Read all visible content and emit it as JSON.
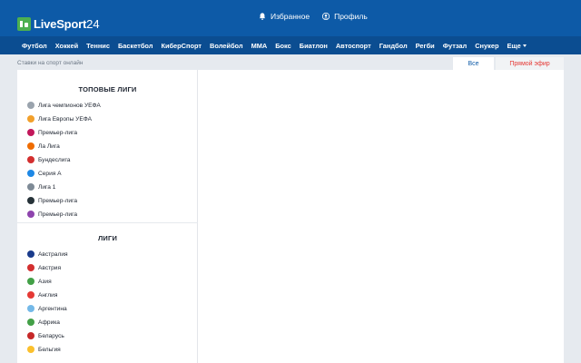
{
  "header": {
    "logo_text": "LiveSport",
    "logo_num": "24",
    "favorites_label": "Избранное",
    "profile_label": "Профиль"
  },
  "nav": {
    "items": [
      "Футбол",
      "Хоккей",
      "Теннис",
      "Баскетбол",
      "КиберСпорт",
      "Волейбол",
      "ММА",
      "Бокс",
      "Биатлон",
      "Автоспорт",
      "Гандбол",
      "Регби",
      "Футзал",
      "Снукер"
    ],
    "more_label": "Еще"
  },
  "subbar": {
    "breadcrumb": "Ставки на спорт онлайн",
    "tab_all": "Все",
    "tab_live": "Прямой эфир"
  },
  "sidebar": {
    "top_title": "ТОПОВЫЕ ЛИГИ",
    "top_leagues": [
      {
        "label": "Лига чемпионов УЕФА",
        "icon": "ucl-star-icon",
        "color": "#9aa3ad"
      },
      {
        "label": "Лига Европы УЕФА",
        "icon": "uel-trophy-icon",
        "color": "#f2a02b"
      },
      {
        "label": "Премьер-лига",
        "icon": "premier-league-icon",
        "color": "#c2185b"
      },
      {
        "label": "Ла Лига",
        "icon": "la-liga-icon",
        "color": "#ef6c00"
      },
      {
        "label": "Бундеслига",
        "icon": "bundesliga-icon",
        "color": "#d32f2f"
      },
      {
        "label": "Серия А",
        "icon": "serie-a-icon",
        "color": "#1e88e5"
      },
      {
        "label": "Лига 1",
        "icon": "ligue-1-icon",
        "color": "#7e8a96"
      },
      {
        "label": "Премьер-лига",
        "icon": "rpl-icon",
        "color": "#263238"
      },
      {
        "label": "Премьер-лига",
        "icon": "premier-league-alt-icon",
        "color": "#8e44ad"
      }
    ],
    "leagues_title": "ЛИГИ",
    "leagues": [
      {
        "label": "Австралия",
        "icon": "flag-australia-icon",
        "color": "#1a3c8c"
      },
      {
        "label": "Австрия",
        "icon": "flag-austria-icon",
        "color": "#d32f2f"
      },
      {
        "label": "Азия",
        "icon": "asia-icon",
        "color": "#43a047"
      },
      {
        "label": "Англия",
        "icon": "flag-england-icon",
        "color": "#e53935"
      },
      {
        "label": "Аргентина",
        "icon": "flag-argentina-icon",
        "color": "#74b9e8"
      },
      {
        "label": "Африка",
        "icon": "africa-icon",
        "color": "#43a047"
      },
      {
        "label": "Беларусь",
        "icon": "flag-belarus-icon",
        "color": "#c62828"
      },
      {
        "label": "Бельгия",
        "icon": "flag-belgium-icon",
        "color": "#fbc02d"
      }
    ]
  }
}
